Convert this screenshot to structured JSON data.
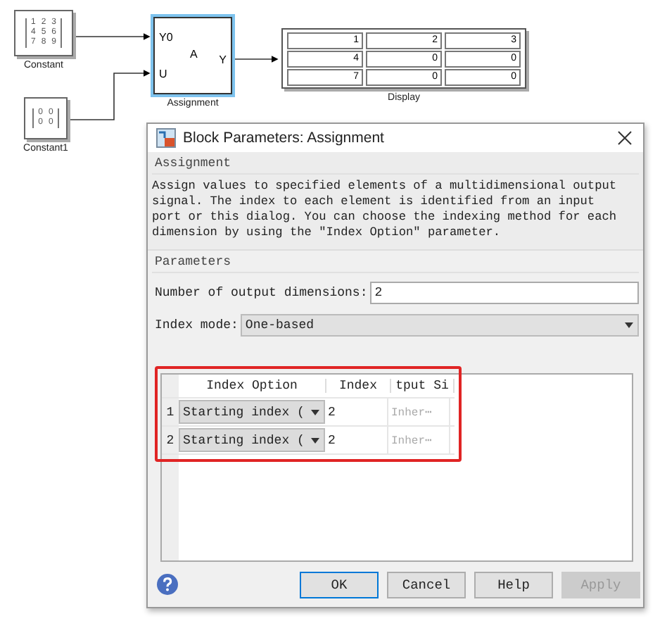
{
  "diagram": {
    "blocks": [
      {
        "kind": "constant",
        "label": "Constant",
        "matrix": [
          [
            "1",
            "2",
            "3"
          ],
          [
            "4",
            "5",
            "6"
          ],
          [
            "7",
            "8",
            "9"
          ]
        ]
      },
      {
        "kind": "constant",
        "label": "Constant1",
        "matrix": [
          [
            "0",
            "0"
          ],
          [
            "0",
            "0"
          ]
        ]
      },
      {
        "kind": "assignment",
        "label": "Assignment",
        "inputs": [
          "Y0",
          "U"
        ],
        "symbol": "A",
        "output": "Y",
        "selected": true
      },
      {
        "kind": "display",
        "label": "Display",
        "values": [
          [
            "1",
            "2",
            "3"
          ],
          [
            "4",
            "0",
            "0"
          ],
          [
            "7",
            "0",
            "0"
          ]
        ]
      }
    ]
  },
  "dialog": {
    "title": "Block Parameters: Assignment",
    "section": "Assignment",
    "description": "Assign values to specified elements of a multidimensional output signal. The index to each element is identified from an input port or this dialog. You can choose the indexing method for each dimension by using the \"Index Option\" parameter.",
    "parameters_heading": "Parameters",
    "fields": [
      {
        "kind": "text",
        "label": "Number of output dimensions:",
        "value": "2"
      },
      {
        "kind": "select",
        "label": "Index mode:",
        "value": "One-based"
      }
    ],
    "table": {
      "highlighted": true,
      "columns": [
        "Index Option",
        "Index",
        "tput Si"
      ],
      "rows": [
        {
          "number": "1",
          "option": "Starting index (",
          "index": "2",
          "size": "Inher⋯"
        },
        {
          "number": "2",
          "option": "Starting index (",
          "index": "2",
          "size": "Inher⋯"
        }
      ]
    },
    "buttons": [
      {
        "label": "OK",
        "default": true,
        "disabled": false
      },
      {
        "label": "Cancel",
        "default": false,
        "disabled": false
      },
      {
        "label": "Help",
        "default": false,
        "disabled": false
      },
      {
        "label": "Apply",
        "default": false,
        "disabled": true
      }
    ]
  }
}
